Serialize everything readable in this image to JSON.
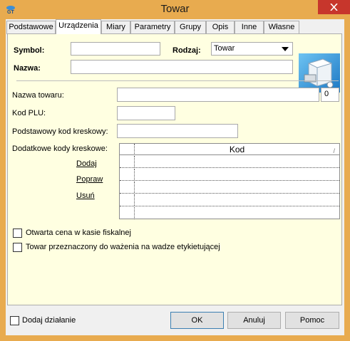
{
  "window": {
    "title": "Towar"
  },
  "tabs": [
    {
      "label": "Podstawowe"
    },
    {
      "label": "Urządzenia"
    },
    {
      "label": "Miary"
    },
    {
      "label": "Parametry"
    },
    {
      "label": "Grupy"
    },
    {
      "label": "Opis"
    },
    {
      "label": "Inne"
    },
    {
      "label": "Własne"
    }
  ],
  "header": {
    "symbol_label": "Symbol:",
    "symbol_value": "",
    "rodzaj_label": "Rodzaj:",
    "rodzaj_value": "Towar",
    "nazwa_label": "Nazwa:",
    "nazwa_value": ""
  },
  "devices": {
    "nazwa_towaru_label": "Nazwa towaru:",
    "nazwa_towaru_value": "",
    "nazwa_towaru_count": "0",
    "kod_plu_label": "Kod PLU:",
    "kod_plu_value": "",
    "kod_kreskowy_label": "Podstawowy kod kreskowy:",
    "kod_kreskowy_value": "",
    "dodatkowe_label": "Dodatkowe kody kreskowe:",
    "links": {
      "dodaj": "Dodaj",
      "popraw": "Popraw",
      "usun": "Usuń"
    },
    "grid_header": "Kod",
    "grid_rows": [
      "",
      "",
      "",
      "",
      ""
    ],
    "checkbox_otwarta_cena": "Otwarta cena w kasie fiskalnej",
    "checkbox_wazenie": "Towar przeznaczony do ważenia na wadze etykietującej"
  },
  "footer": {
    "dodaj_dzialanie": "Dodaj działanie",
    "ok": "OK",
    "anuluj": "Anuluj",
    "pomoc": "Pomoc"
  },
  "colors": {
    "frame": "#e8ab4f",
    "page_bg": "#ffffe1",
    "close": "#c7362c"
  },
  "icons": {
    "app": "app-logo-icon",
    "close": "close-icon",
    "dropdown": "chevron-down-icon",
    "product": "product-box-icon"
  }
}
